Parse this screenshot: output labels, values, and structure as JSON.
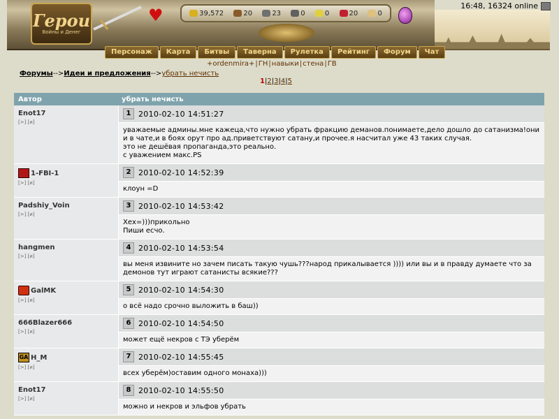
{
  "header": {
    "logo_main": "Герои",
    "logo_sub": "Войны и Денег",
    "time_online": "16:48, 16324 online",
    "resources": [
      {
        "icon": "gold-icon",
        "color": "#d8b020",
        "value": "39,572"
      },
      {
        "icon": "wood-icon",
        "color": "#8a5a2a",
        "value": "20"
      },
      {
        "icon": "ore-icon",
        "color": "#707070",
        "value": "23"
      },
      {
        "icon": "mercury-icon",
        "color": "#606060",
        "value": "0"
      },
      {
        "icon": "sulfur-icon",
        "color": "#e0d040",
        "value": "0"
      },
      {
        "icon": "crystal-icon",
        "color": "#c02030",
        "value": "20"
      },
      {
        "icon": "gems-icon",
        "color": "#e0c080",
        "value": "0"
      }
    ]
  },
  "menu": [
    "Персонаж",
    "Карта",
    "Битвы",
    "Таверна",
    "Рулетка",
    "Рейтинг",
    "Форум",
    "Чат"
  ],
  "submenu": [
    "+ordenmira+",
    "ГН",
    "навыки",
    "стена",
    "ГВ"
  ],
  "breadcrumb": {
    "forums": "Форумы",
    "arrow": "-->",
    "section": "Идеи и предложения",
    "topic": "убрать нечисть"
  },
  "pages": {
    "current": "1",
    "others": [
      "2",
      "3",
      "4",
      "5"
    ]
  },
  "table": {
    "col_author": "Автор",
    "col_topic": "убрать нечисть",
    "author_links": "[>] [и]",
    "posts": [
      {
        "no": "1",
        "author": "Enot17",
        "avatar": "",
        "date": "2010-02-10 14:51:27",
        "text": [
          "уважаемые админы.мне кажеца,что нужно убрать фракцию деманов.понимаете,дело дошло до сатанизма!они и в чате,и в боях орут про ад.приветствуют сатану,и прочее.я насчитал уже 43 таких случая.",
          "это не дешёвая пропаганда,это реально.",
          "с уважением макс.PS"
        ]
      },
      {
        "no": "2",
        "author": "1-FBI-1",
        "avatar": "av-red",
        "date": "2010-02-10 14:52:39",
        "text": [
          "клоун =D"
        ]
      },
      {
        "no": "3",
        "author": "Padshiy_Voin",
        "avatar": "",
        "date": "2010-02-10 14:53:42",
        "text": [
          "Хех=)))прикольно",
          "Пиши есчо."
        ]
      },
      {
        "no": "4",
        "author": "hangmen",
        "avatar": "",
        "date": "2010-02-10 14:53:54",
        "text": [
          "вы меня извините но зачем писать такую чушь???народ прикалывается )))) или вы и в правду думаете что за демонов тут играют сатанисты всякие???"
        ]
      },
      {
        "no": "5",
        "author": "GalMK",
        "avatar": "av-cube",
        "date": "2010-02-10 14:54:30",
        "text": [
          "о всё надо срочно выложить в баш))"
        ]
      },
      {
        "no": "6",
        "author": "666Blazer666",
        "avatar": "",
        "date": "2010-02-10 14:54:50",
        "text": [
          "может ещё некров с ТЭ уберём"
        ]
      },
      {
        "no": "7",
        "author": "H_M",
        "avatar": "av-ga",
        "avatar_text": "GA",
        "date": "2010-02-10 14:55:45",
        "text": [
          "всех уберём)оставим одного монаха)))"
        ]
      },
      {
        "no": "8",
        "author": "Enot17",
        "avatar": "",
        "date": "2010-02-10 14:55:50",
        "text": [
          "можно и некров и эльфов убрать"
        ]
      }
    ]
  }
}
